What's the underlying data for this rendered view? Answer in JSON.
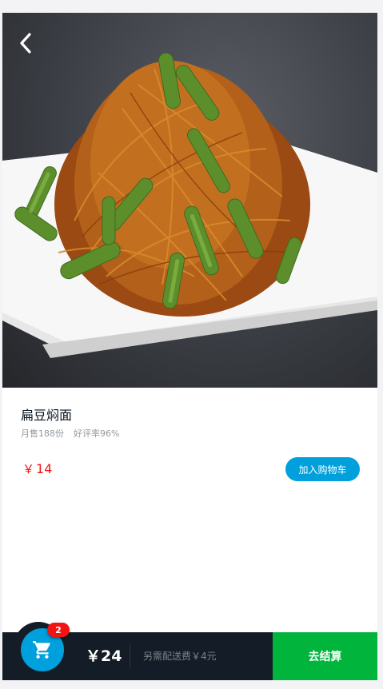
{
  "food": {
    "name": "扁豆焖面",
    "sales": "月售188份",
    "rating": "好评率96%",
    "price_symbol": "￥",
    "price": "14",
    "add_cart_label": "加入购物车",
    "image_alt": "扁豆焖面图片"
  },
  "cart": {
    "count": "2",
    "total": "￥24",
    "delivery_note": "另需配送费￥4元",
    "checkout_label": "去结算"
  },
  "colors": {
    "accent_blue": "#00a0dc",
    "price_red": "#f01414",
    "checkout_green": "#00b43c",
    "cartbar_dark": "#141d27"
  },
  "icons": {
    "back": "chevron-left-icon",
    "cart": "shopping-cart-icon"
  }
}
